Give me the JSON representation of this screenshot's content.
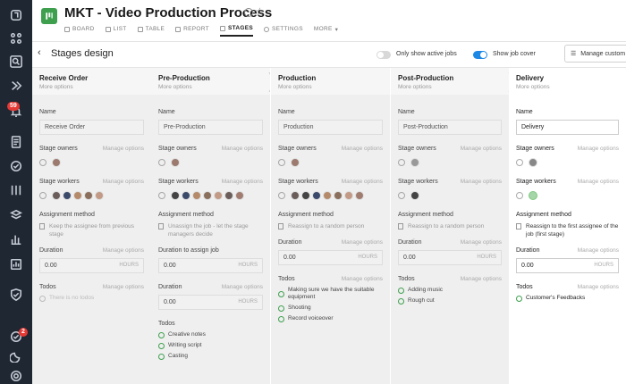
{
  "rail": {
    "notif_count": "59",
    "chat_count": "2"
  },
  "header": {
    "title": "MKT - Video Production Process",
    "tabs": [
      "BOARD",
      "LIST",
      "TABLE",
      "REPORT",
      "STAGES",
      "SETTINGS",
      "MORE"
    ]
  },
  "subheader": {
    "title": "Stages design",
    "toggle_active": "Only show active jobs",
    "toggle_cover": "Show job cover",
    "manage_button": "Manage custom"
  },
  "labels": {
    "more_options": "More options",
    "name": "Name",
    "stage_owners": "Stage owners",
    "stage_workers": "Stage workers",
    "manage_options": "Manage options",
    "assignment_method": "Assignment method",
    "duration": "Duration",
    "duration_assign": "Duration to assign job",
    "todos": "Todos",
    "hours": "HOURS"
  },
  "columns": [
    {
      "name": "Receive Order",
      "value": "Receive Order",
      "assignment": "Keep the assignee from previous stage",
      "duration": "0.00",
      "todos": [],
      "empty_todo": "There is no todos"
    },
    {
      "name": "Pre-Production",
      "value": "Pre-Production",
      "assignment": "Unassign the job - let the stage managers decide",
      "duration_assign": "0.00",
      "duration": "0.00",
      "todos": [
        "Creative notes",
        "Writing script",
        "Casting"
      ]
    },
    {
      "name": "Production",
      "value": "Production",
      "assignment": "Reassign to a random person",
      "duration": "0.00",
      "todos": [
        "Making sure we have the suitable equipment",
        "Shooting",
        "Record voiceover"
      ]
    },
    {
      "name": "Post-Production",
      "value": "Post-Production",
      "assignment": "Reassign to a random person",
      "duration": "0.00",
      "todos": [
        "Adding music",
        "Rough cut"
      ]
    },
    {
      "name": "Delivery",
      "value": "Delivery",
      "assignment": "Reassign to the first assignee of the job (first stage)",
      "duration": "0.00",
      "todos": [
        "Customer's Feedbacks"
      ]
    }
  ]
}
